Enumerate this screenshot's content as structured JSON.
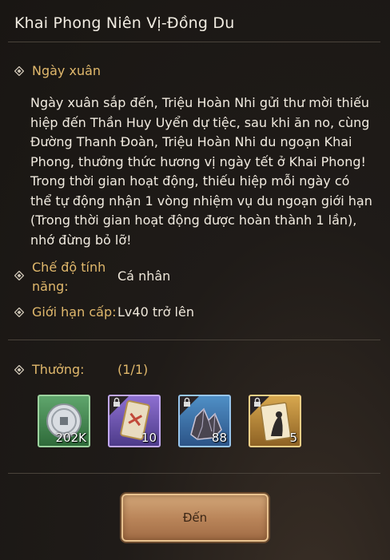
{
  "header": {
    "title": "Khai Phong Niên Vị-Đồng Du"
  },
  "section": {
    "heading": "Ngày xuân"
  },
  "description": "Ngày xuân sắp đến, Triệu Hoàn Nhi gửi thư mời thiếu hiệp đến Thần Huy Uyển dự tiệc, sau khi ăn no, cùng Đường Thanh Đoàn, Triệu Hoàn Nhi du ngoạn Khai Phong, thưởng thức hương vị ngày tết ở Khai Phong! Trong thời gian hoạt động, thiếu hiệp mỗi ngày có thể tự động nhận 1 vòng nhiệm vụ du ngoạn giới hạn (Trong thời gian hoạt động được hoàn thành 1 lần), nhớ đừng bỏ lỡ!",
  "mode": {
    "label_line1": "Chế độ tính",
    "label_line2": "năng:",
    "value": "Cá nhân"
  },
  "level": {
    "label": "Giới hạn cấp:",
    "value": "Lv40 trở lên"
  },
  "rewards": {
    "label": "Thưởng:",
    "count": "(1/1)",
    "items": [
      {
        "icon": "silver-coin-icon",
        "qty": "202K",
        "rarity": "green",
        "locked": false
      },
      {
        "icon": "scroll-card-icon",
        "qty": "10",
        "rarity": "purple",
        "locked": true
      },
      {
        "icon": "crystal-ore-icon",
        "qty": "88",
        "rarity": "blue",
        "locked": true
      },
      {
        "icon": "event-card-icon",
        "qty": "5",
        "rarity": "gold",
        "locked": true
      }
    ]
  },
  "action": {
    "go_label": "Đến"
  },
  "colors": {
    "accent": "#e0b86c",
    "text": "#f1ebe0",
    "background": "#1f1b18"
  }
}
